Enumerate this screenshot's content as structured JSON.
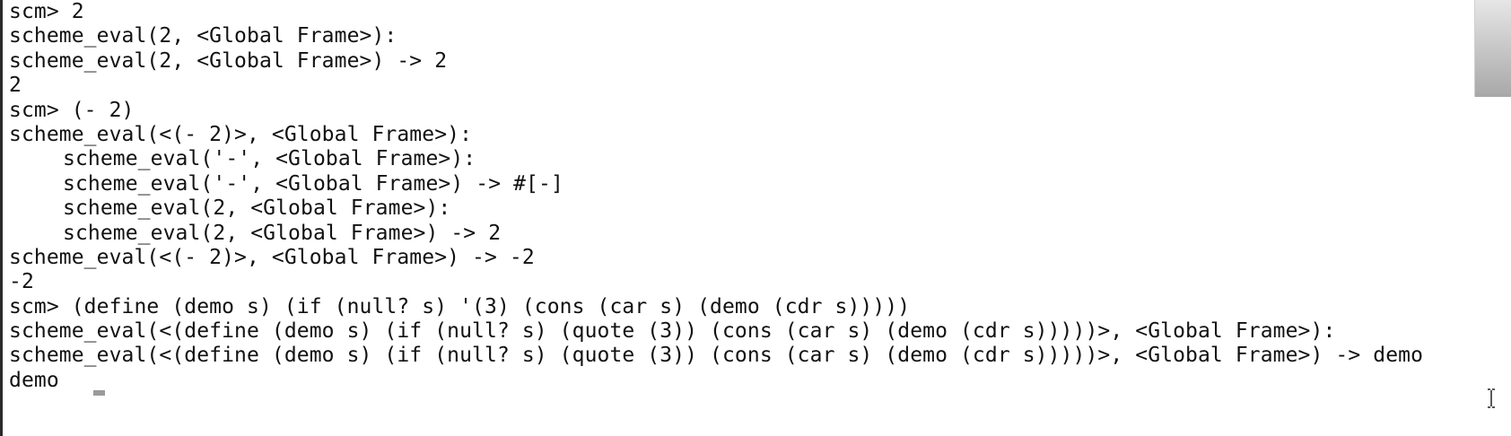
{
  "terminal": {
    "lines": [
      "scm> 2",
      "scheme_eval(2, <Global Frame>):",
      "scheme_eval(2, <Global Frame>) -> 2",
      "2",
      "scm> (- 2)",
      "scheme_eval(<(- 2)>, <Global Frame>):",
      "scheme_eval('-', <Global Frame>):",
      "scheme_eval('-', <Global Frame>) -> #[-]",
      "scheme_eval(2, <Global Frame>):",
      "scheme_eval(2, <Global Frame>) -> 2",
      "scheme_eval(<(- 2)>, <Global Frame>) -> -2",
      "-2",
      "scm> (define (demo s) (if (null? s) '(3) (cons (car s) (demo (cdr s)))))",
      "scheme_eval(<(define (demo s) (if (null? s) (quote (3)) (cons (car s) (demo (cdr s)))))>, <Global Frame>):",
      "scheme_eval(<(define (demo s) (if (null? s) (quote (3)) (cons (car s) (demo (cdr s)))))>, <Global Frame>) -> demo",
      "demo"
    ]
  },
  "icons": {
    "cursor": "text-cursor-block-icon",
    "mouse": "i-beam-cursor-icon"
  }
}
